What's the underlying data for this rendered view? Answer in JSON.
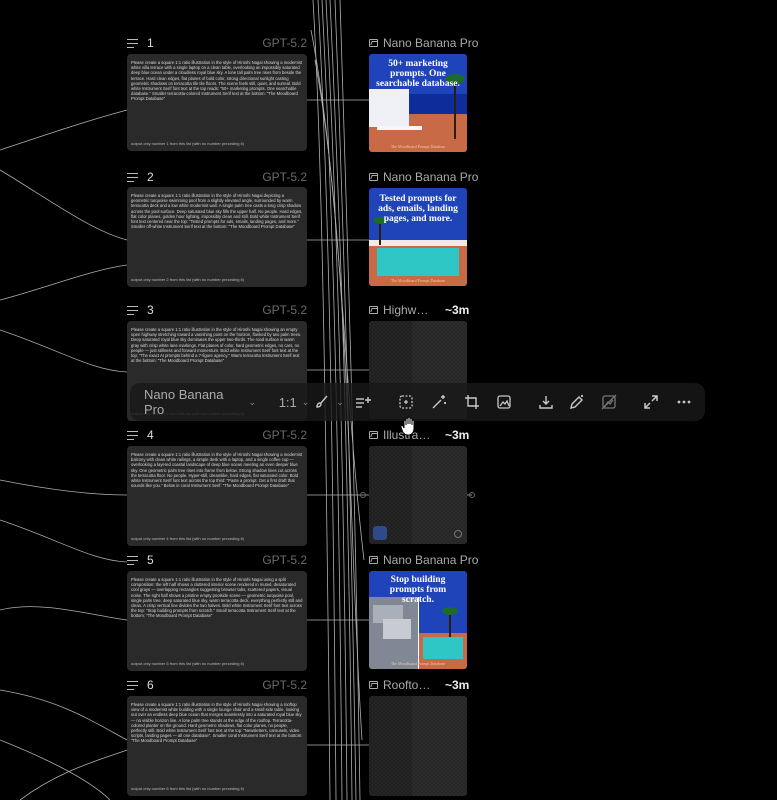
{
  "rows": [
    {
      "num": "1",
      "model": "GPT-5.2",
      "prompt": "Please create a square 1:1 ratio illustration in the style of Hiroshi Nagai showing a modernist white villa terrace with a single laptop on a clean table, overlooking an impossibly saturated deep blue ocean under a cloudless royal blue sky. A lone tall palm tree rises from beside the terrace. Hard clean edges, flat planes of bold color, strong directional sunlight casting geometric shadows on terracotta tile tile floors. The scene feels still, quiet, and surreal. Bold white Instrument Serif font text at the top reads: \"50+ marketing prompts. One searchable database.\" Smaller terracotta-colored Instrument Serif text at the bottom: \"The Moodboard Prompt Database\"",
      "footer": "output only number 1 from this list (with no number preceding it)",
      "image_title": "Nano Banana Pro",
      "image_time": "",
      "poster_title": "50+ marketing prompts. One searchable database.",
      "poster_footer": "The Moodboard Prompt Database"
    },
    {
      "num": "2",
      "model": "GPT-5.2",
      "prompt": "Please create a square 1:1 ratio illustration in the style of Hiroshi Nagai depicting a geometric turquoise swimming pool from a slightly elevated angle, surrounded by warm terracotta deck and a low white modernist wall. A single palm tree casts a long crisp shadow across the pool surface. Deep saturated blue sky fills the upper half. No people. Hard edges, flat color planes, golden hour lighting, impossibly clean and still. Bold white Instrument Serif font text centered near the top: \"Tested prompts for ads, emails, landing pages, and more.\" Smaller off-white Instrument Serif text at the bottom: \"The Moodboard Prompt Database\"",
      "footer": "output only number 2 from this list (with no number preceding it)",
      "image_title": "Nano Banana Pro",
      "image_time": "",
      "poster_title": "Tested prompts for ads, emails, landing pages, and more.",
      "poster_footer": "The Moodboard Prompt Database"
    },
    {
      "num": "3",
      "model": "GPT-5.2",
      "prompt": "Please create a square 1:1 ratio illustration in the style of Hiroshi Nagai showing an empty open highway stretching toward a vanishing point on the horizon, flanked by two palm trees. Deep saturated royal blue sky dominates the upper two-thirds. The road surface is warm gray with crisp white lane markings. Flat planes of color, hard geometric edges, no cars, no people — just stillness and forward momentum. Bold white Instrument Serif font text at the top: \"The exact AI prompts behind a 7-figure agency.\" Warm terracotta Instrument Serif text at the bottom: \"The Moodboard Prompt Database\"",
      "footer": "output only number 3 from this list (with no number preceding it)",
      "image_title": "Highw…",
      "image_time": "~3m",
      "poster_title": "",
      "poster_footer": ""
    },
    {
      "num": "4",
      "model": "GPT-5.2",
      "prompt": "Please create a square 1:1 ratio illustration in the style of Hiroshi Nagai showing a modernist balcony with clean white railings, a simple desk with a laptop, and a single coffee cup — overlooking a layered coastal landscape of deep blue ocean meeting an even deeper blue sky. One geometric palm tree rises into frame from below. Strong shadow lines cut across the terracotta floor. No people. Hyper-still, dreamlike, hard edges, flat saturated color. Bold white Instrument Serif font text across the top third: \"Paste a prompt. Get a first draft that sounds like you.\" Below in coral Instrument Serif: \"The Moodboard Prompt Database\"",
      "footer": "output only number 4 from this list (with no number preceding it)",
      "image_title": "Illustra…",
      "image_time": "~3m",
      "poster_title": "",
      "poster_footer": ""
    },
    {
      "num": "5",
      "model": "GPT-5.2",
      "prompt": "Please create a square 1:1 ratio illustration in the style of Hiroshi Nagai using a split composition: the left half shows a cluttered interior scene rendered in muted, desaturated cool grays — overlapping rectangles suggesting browser tabs, scattered papers, visual noise. The right half shows a pristine empty poolside scene — geometric turquoise pool, single palm tree, deep saturated blue sky, warm terracotta deck, everything perfectly still and clean. A crisp vertical line divides the two halves. Bold white Instrument Serif font text across the top: \"Stop building prompts from scratch.\" Small terracotta Instrument Serif text at the bottom: \"The Moodboard Prompt Database\"",
      "footer": "output only number 5 from this list (with no number preceding it)",
      "image_title": "Nano Banana Pro",
      "image_time": "",
      "poster_title": "Stop building prompts from scratch.",
      "poster_footer": "The Moodboard Prompt Database"
    },
    {
      "num": "6",
      "model": "GPT-5.2",
      "prompt": "Please create a square 1:1 ratio illustration in the style of Hiroshi Nagai showing a rooftop view of a modernist white building with a single lounge chair and a small side table, looking out over an endless deep blue ocean that merges seamlessly into a saturated royal blue sky — no visible horizon line. A lone palm tree stands at the edge of the rooftop. Terracotta-colored planter on the ground. Hard geometric shadows, flat color planes, no people, perfectly still. Bold white Instrument Serif font text at the top: \"Newsletters, carousels, video scripts, landing pages — all one database\". Smaller coral Instrument Serif text at the bottom: \"The Moodboard Prompt Database\"",
      "footer": "output only number 6 from this list (with no number preceding it)",
      "image_title": "Roofto…",
      "image_time": "~3m",
      "poster_title": "",
      "poster_footer": ""
    }
  ],
  "toolbar": {
    "model": "Nano Banana Pro",
    "ratio": "1:1"
  },
  "icons": {
    "row": "text-lines-icon",
    "image": "image-icon",
    "brush": "brush-icon",
    "sparkle-lines": "sparkle-lines-icon",
    "select": "select-region-icon",
    "magic": "magic-wand-icon",
    "crop": "crop-icon",
    "image-edit": "image-edit-icon",
    "download": "download-icon",
    "pen": "pen-sparkle-icon",
    "no-image": "image-off-icon",
    "expand": "expand-icon",
    "more": "more-dots-icon",
    "cursor": "hand-cursor-icon"
  },
  "colors": {
    "background": "#000000",
    "card": "#2a2a2a",
    "sky": "#1f43b8",
    "pool": "#2fc6c6",
    "terracotta": "#c76a45"
  }
}
